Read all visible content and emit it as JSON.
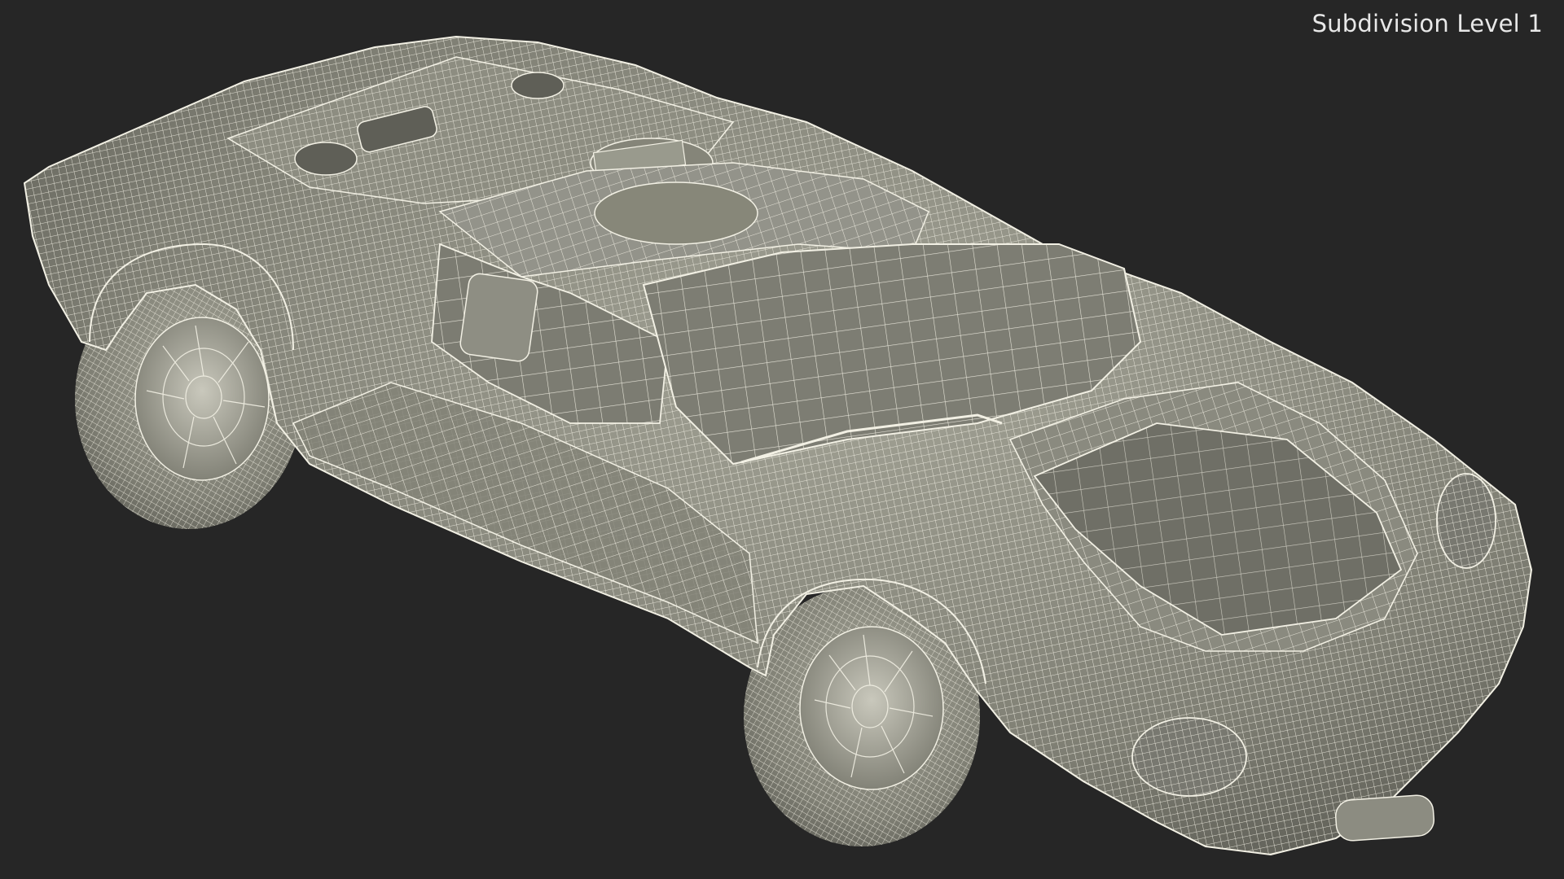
{
  "viewport": {
    "label": "Subdivision Level 1",
    "background_color": "#262626",
    "model_fill_color": "#8a8a7e",
    "wire_color": "#f2f0e4"
  },
  "model": {
    "icon": "car-wireframe-icon"
  }
}
